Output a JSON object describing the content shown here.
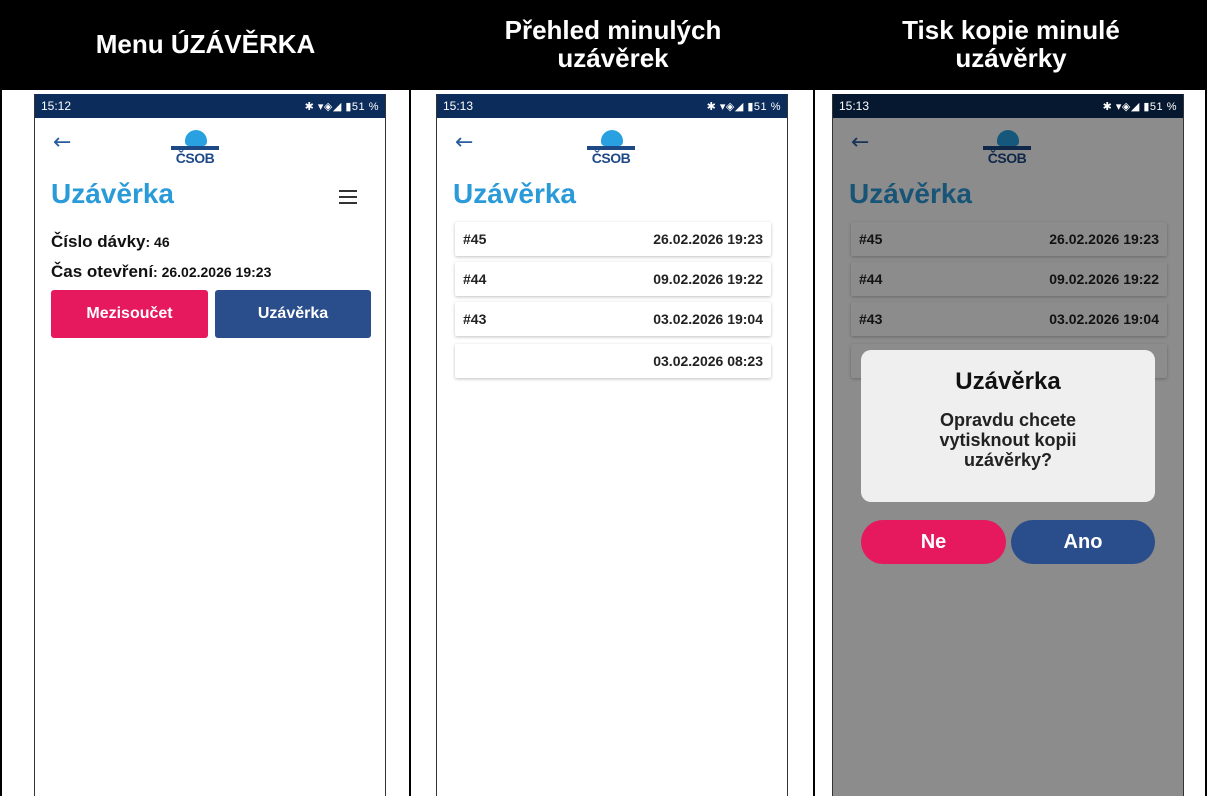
{
  "columns": [
    {
      "header": "Menu ÚZÁVĚRKA"
    },
    {
      "header": "Přehled minulých uzávěrek"
    },
    {
      "header": "Tisk kopie minulé uzávěrky"
    }
  ],
  "status": {
    "time1": "15:12",
    "time2": "15:13",
    "time3": "15:13",
    "icons": "✱ ▾◈◢ ▮51 %"
  },
  "logo_text": "ČSOB",
  "back_icon": "←",
  "screen1": {
    "title": "Uzávěrka",
    "batch_label": "Číslo dávky",
    "batch_value": ": 46",
    "opened_label": "Čas otevření",
    "opened_value": ": 26.02.2026 19:23",
    "subtotal_button": "Mezisoučet",
    "close_button": "Uzávěrka"
  },
  "screen2": {
    "title": "Uzávěrka",
    "rows": [
      {
        "id": "#45",
        "date": "26.02.2026 19:23"
      },
      {
        "id": "#44",
        "date": "09.02.2026 19:22"
      },
      {
        "id": "#43",
        "date": "03.02.2026 19:04"
      },
      {
        "id": "",
        "date": "03.02.2026 08:23"
      }
    ]
  },
  "screen3": {
    "title": "Uzávěrka",
    "rows": [
      {
        "id": "#45",
        "date": "26.02.2026 19:23"
      },
      {
        "id": "#44",
        "date": "09.02.2026 19:22"
      },
      {
        "id": "#43",
        "date": "03.02.2026 19:04"
      }
    ],
    "dialog_title": "Uzávěrka",
    "dialog_message": "Opravdu chcete vytisknout kopii uzávěrky?",
    "no_button": "Ne",
    "yes_button": "Ano"
  },
  "colors": {
    "brand_blue": "#2a9ad8",
    "navy": "#2a4d8c",
    "pink": "#e6185e",
    "status_bar": "#0c2c5c"
  }
}
